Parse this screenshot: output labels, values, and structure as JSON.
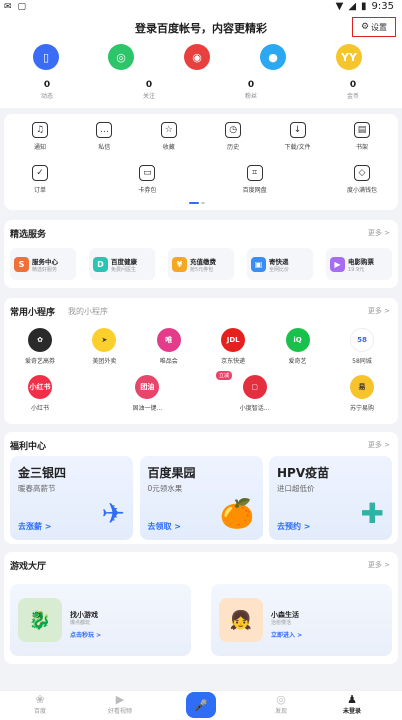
{
  "status": {
    "time": "9:35"
  },
  "header": {
    "title": "登录百度帐号，内容更精彩",
    "settings_label": "设置"
  },
  "social": [
    {
      "icon": "phone-icon",
      "color": "#3b6cf6",
      "glyph": "▯"
    },
    {
      "icon": "wechat-icon",
      "color": "#2dc56a",
      "glyph": "◎"
    },
    {
      "icon": "weibo-icon",
      "color": "#e8403f",
      "glyph": "◉"
    },
    {
      "icon": "qq-icon",
      "color": "#2aa8f2",
      "glyph": "●"
    },
    {
      "icon": "yy-icon",
      "color": "#f6c42d",
      "glyph": "YY"
    }
  ],
  "stats": [
    {
      "num": "0",
      "label": "动态"
    },
    {
      "num": "0",
      "label": "关注"
    },
    {
      "num": "0",
      "label": "粉丝"
    },
    {
      "num": "0",
      "label": "金币"
    }
  ],
  "tools": [
    {
      "label": "通知",
      "icon": "bell-icon",
      "glyph": "♫"
    },
    {
      "label": "私信",
      "icon": "message-icon",
      "glyph": "…"
    },
    {
      "label": "收藏",
      "icon": "star-icon",
      "glyph": "☆"
    },
    {
      "label": "历史",
      "icon": "clock-icon",
      "glyph": "◷"
    },
    {
      "label": "下载/文件",
      "icon": "download-icon",
      "glyph": "↓"
    },
    {
      "label": "书架",
      "icon": "book-icon",
      "glyph": "▤"
    },
    {
      "label": "订单",
      "icon": "order-icon",
      "glyph": "✓"
    },
    {
      "label": "卡券包",
      "icon": "coupon-icon",
      "glyph": "▭"
    },
    {
      "label": "百度网盘",
      "icon": "cloud-icon",
      "glyph": "⌗"
    },
    {
      "label": "度小满钱包",
      "icon": "wallet-icon",
      "glyph": "◇"
    }
  ],
  "services": {
    "title": "精选服务",
    "more": "更多 >",
    "items": [
      {
        "name": "服务中心",
        "sub": "精选好服务",
        "color": "#f0703a",
        "glyph": "S"
      },
      {
        "name": "百度健康",
        "sub": "免费问医生",
        "color": "#2bc3b3",
        "glyph": "D"
      },
      {
        "name": "充值缴费",
        "sub": "抢5元券包",
        "color": "#f5a623",
        "glyph": "¥"
      },
      {
        "name": "寄快递",
        "sub": "全网比价",
        "color": "#3a8df5",
        "glyph": "▣"
      },
      {
        "name": "电影购票",
        "sub": "19.9元",
        "color": "#a66cf2",
        "glyph": "▶"
      }
    ]
  },
  "mini": {
    "tab_active": "常用小程序",
    "tab_inactive": "我的小程序",
    "more": "更多 >",
    "apps": [
      {
        "label": "爱奇艺高券",
        "color": "#2a2a2a",
        "glyph": "✿"
      },
      {
        "label": "美团外卖",
        "color": "#fbd02c",
        "glyph": "➤"
      },
      {
        "label": "唯品会",
        "color": "#e43c8a",
        "glyph": "唯"
      },
      {
        "label": "京东快递",
        "color": "#e4211e",
        "glyph": "JDL"
      },
      {
        "label": "爱奇艺",
        "color": "#17c14b",
        "glyph": "iQ"
      },
      {
        "label": "58同城",
        "color": "#ffffff",
        "glyph": "58"
      },
      {
        "label": "小红书",
        "color": "#f03048",
        "glyph": "小红书"
      },
      {
        "label": "固油一键...",
        "color": "#e8456a",
        "glyph": "团油"
      },
      {
        "label": "小度智话...",
        "color": "#e52f3f",
        "glyph": "▢"
      },
      {
        "label": "苏宁易购",
        "color": "#f7c32b",
        "glyph": "易"
      }
    ],
    "badge": "立减"
  },
  "welfare": {
    "title": "福利中心",
    "more": "更多 >",
    "cards": [
      {
        "title": "金三银四",
        "sub": "暖春高薪节",
        "go": "去涨薪 >",
        "art": "✈"
      },
      {
        "title": "百度果园",
        "sub": "0元领水果",
        "go": "去领取 >",
        "art": "🍊"
      },
      {
        "title": "HPV疫苗",
        "sub": "进口超低价",
        "go": "去预约 >",
        "art": "✚"
      }
    ]
  },
  "games": {
    "title": "游戏大厅",
    "more": "更多 >",
    "items": [
      {
        "name": "找小游戏",
        "sub": "爆点都玩",
        "go": "点击秒玩 >",
        "art": "🐉"
      },
      {
        "name": "小森生活",
        "sub": "治愈慢活",
        "go": "立即进入 >",
        "art": "👧"
      }
    ]
  },
  "nav": [
    {
      "label": "百度",
      "icon": "paw-icon",
      "glyph": "❀"
    },
    {
      "label": "好看视频",
      "icon": "play-icon",
      "glyph": "▶"
    },
    {
      "label": "",
      "icon": "voice-icon",
      "glyph": "🎤"
    },
    {
      "label": "发现",
      "icon": "compass-icon",
      "glyph": "◎"
    },
    {
      "label": "未登录",
      "icon": "user-icon",
      "glyph": "♟"
    }
  ],
  "colors": {
    "accent": "#2f6df6",
    "highlight": "#e02020"
  }
}
